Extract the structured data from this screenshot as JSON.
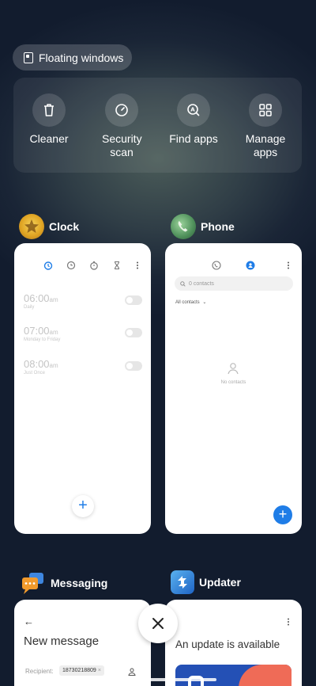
{
  "floating_windows": {
    "label": "Floating windows"
  },
  "tools": [
    {
      "icon": "trash-icon",
      "label": "Cleaner"
    },
    {
      "icon": "shield-check-icon",
      "label": "Security scan"
    },
    {
      "icon": "search-apps-icon",
      "label": "Find apps"
    },
    {
      "icon": "grid-icon",
      "label": "Manage apps"
    }
  ],
  "apps": {
    "clock": {
      "name": "Clock",
      "alarms": [
        {
          "time": "06:00",
          "ampm": "am",
          "repeat": "Daily"
        },
        {
          "time": "07:00",
          "ampm": "am",
          "repeat": "Monday to Friday"
        },
        {
          "time": "08:00",
          "ampm": "am",
          "repeat": "Just Once"
        }
      ],
      "fab": "+"
    },
    "phone": {
      "name": "Phone",
      "search_placeholder": "0 contacts",
      "filter_label": "All contacts",
      "empty_label": "No contacts",
      "fab": "+"
    },
    "messaging": {
      "name": "Messaging",
      "back": "←",
      "title": "New message",
      "recipient_label": "Recipient:",
      "recipient_value": "18730218809"
    },
    "updater": {
      "name": "Updater",
      "title": "An update is available"
    }
  },
  "colors": {
    "accent_blue": "#1f7de7",
    "updater_orange": "#ef6b57"
  }
}
